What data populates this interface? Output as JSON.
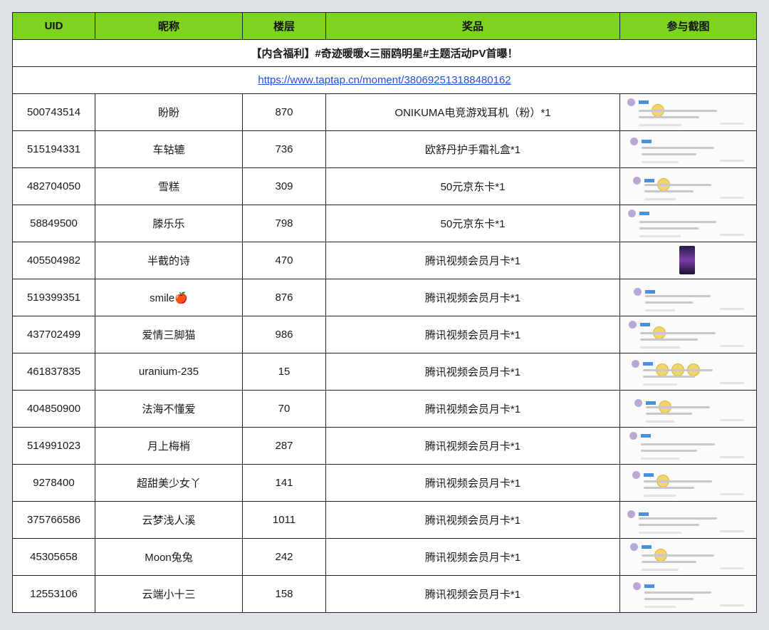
{
  "columns": [
    "UID",
    "昵称",
    "楼层",
    "奖品",
    "参与截图"
  ],
  "banner": "【内含福利】#奇迹暖暖x三丽鸥明星#主题活动PV首曝！",
  "link": "https://www.taptap.cn/moment/380692513188480162",
  "rows": [
    {
      "uid": "500743514",
      "nickname": "盼盼",
      "floor": "870",
      "prize": "ONIKUMA电竞游戏耳机（粉）*1"
    },
    {
      "uid": "515194331",
      "nickname": "车轱辘",
      "floor": "736",
      "prize": "欧舒丹护手霜礼盒*1"
    },
    {
      "uid": "482704050",
      "nickname": "雪糕",
      "floor": "309",
      "prize": "50元京东卡*1"
    },
    {
      "uid": "58849500",
      "nickname": "滕乐乐",
      "floor": "798",
      "prize": "50元京东卡*1"
    },
    {
      "uid": "405504982",
      "nickname": "半截的诗",
      "floor": "470",
      "prize": "腾讯视频会员月卡*1"
    },
    {
      "uid": "519399351",
      "nickname": "smile🍎",
      "floor": "876",
      "prize": "腾讯视频会员月卡*1"
    },
    {
      "uid": "437702499",
      "nickname": "爱情三脚猫",
      "floor": "986",
      "prize": "腾讯视频会员月卡*1"
    },
    {
      "uid": "461837835",
      "nickname": "uranium-235",
      "floor": "15",
      "prize": "腾讯视频会员月卡*1"
    },
    {
      "uid": "404850900",
      "nickname": "法海不懂爱",
      "floor": "70",
      "prize": "腾讯视频会员月卡*1"
    },
    {
      "uid": "514991023",
      "nickname": "月上梅梢",
      "floor": "287",
      "prize": "腾讯视频会员月卡*1"
    },
    {
      "uid": "9278400",
      "nickname": "超甜美少女丫",
      "floor": "141",
      "prize": "腾讯视频会员月卡*1"
    },
    {
      "uid": "375766586",
      "nickname": "云梦浅人溪",
      "floor": "1011",
      "prize": "腾讯视频会员月卡*1"
    },
    {
      "uid": "45305658",
      "nickname": "Moon兔兔",
      "floor": "242",
      "prize": "腾讯视频会员月卡*1"
    },
    {
      "uid": "12553106",
      "nickname": "云端小十三",
      "floor": "158",
      "prize": "腾讯视频会员月卡*1"
    }
  ],
  "colors": {
    "header_bg": "#7ed321",
    "link": "#1a56d6",
    "page_bg": "#dfe3e7"
  }
}
